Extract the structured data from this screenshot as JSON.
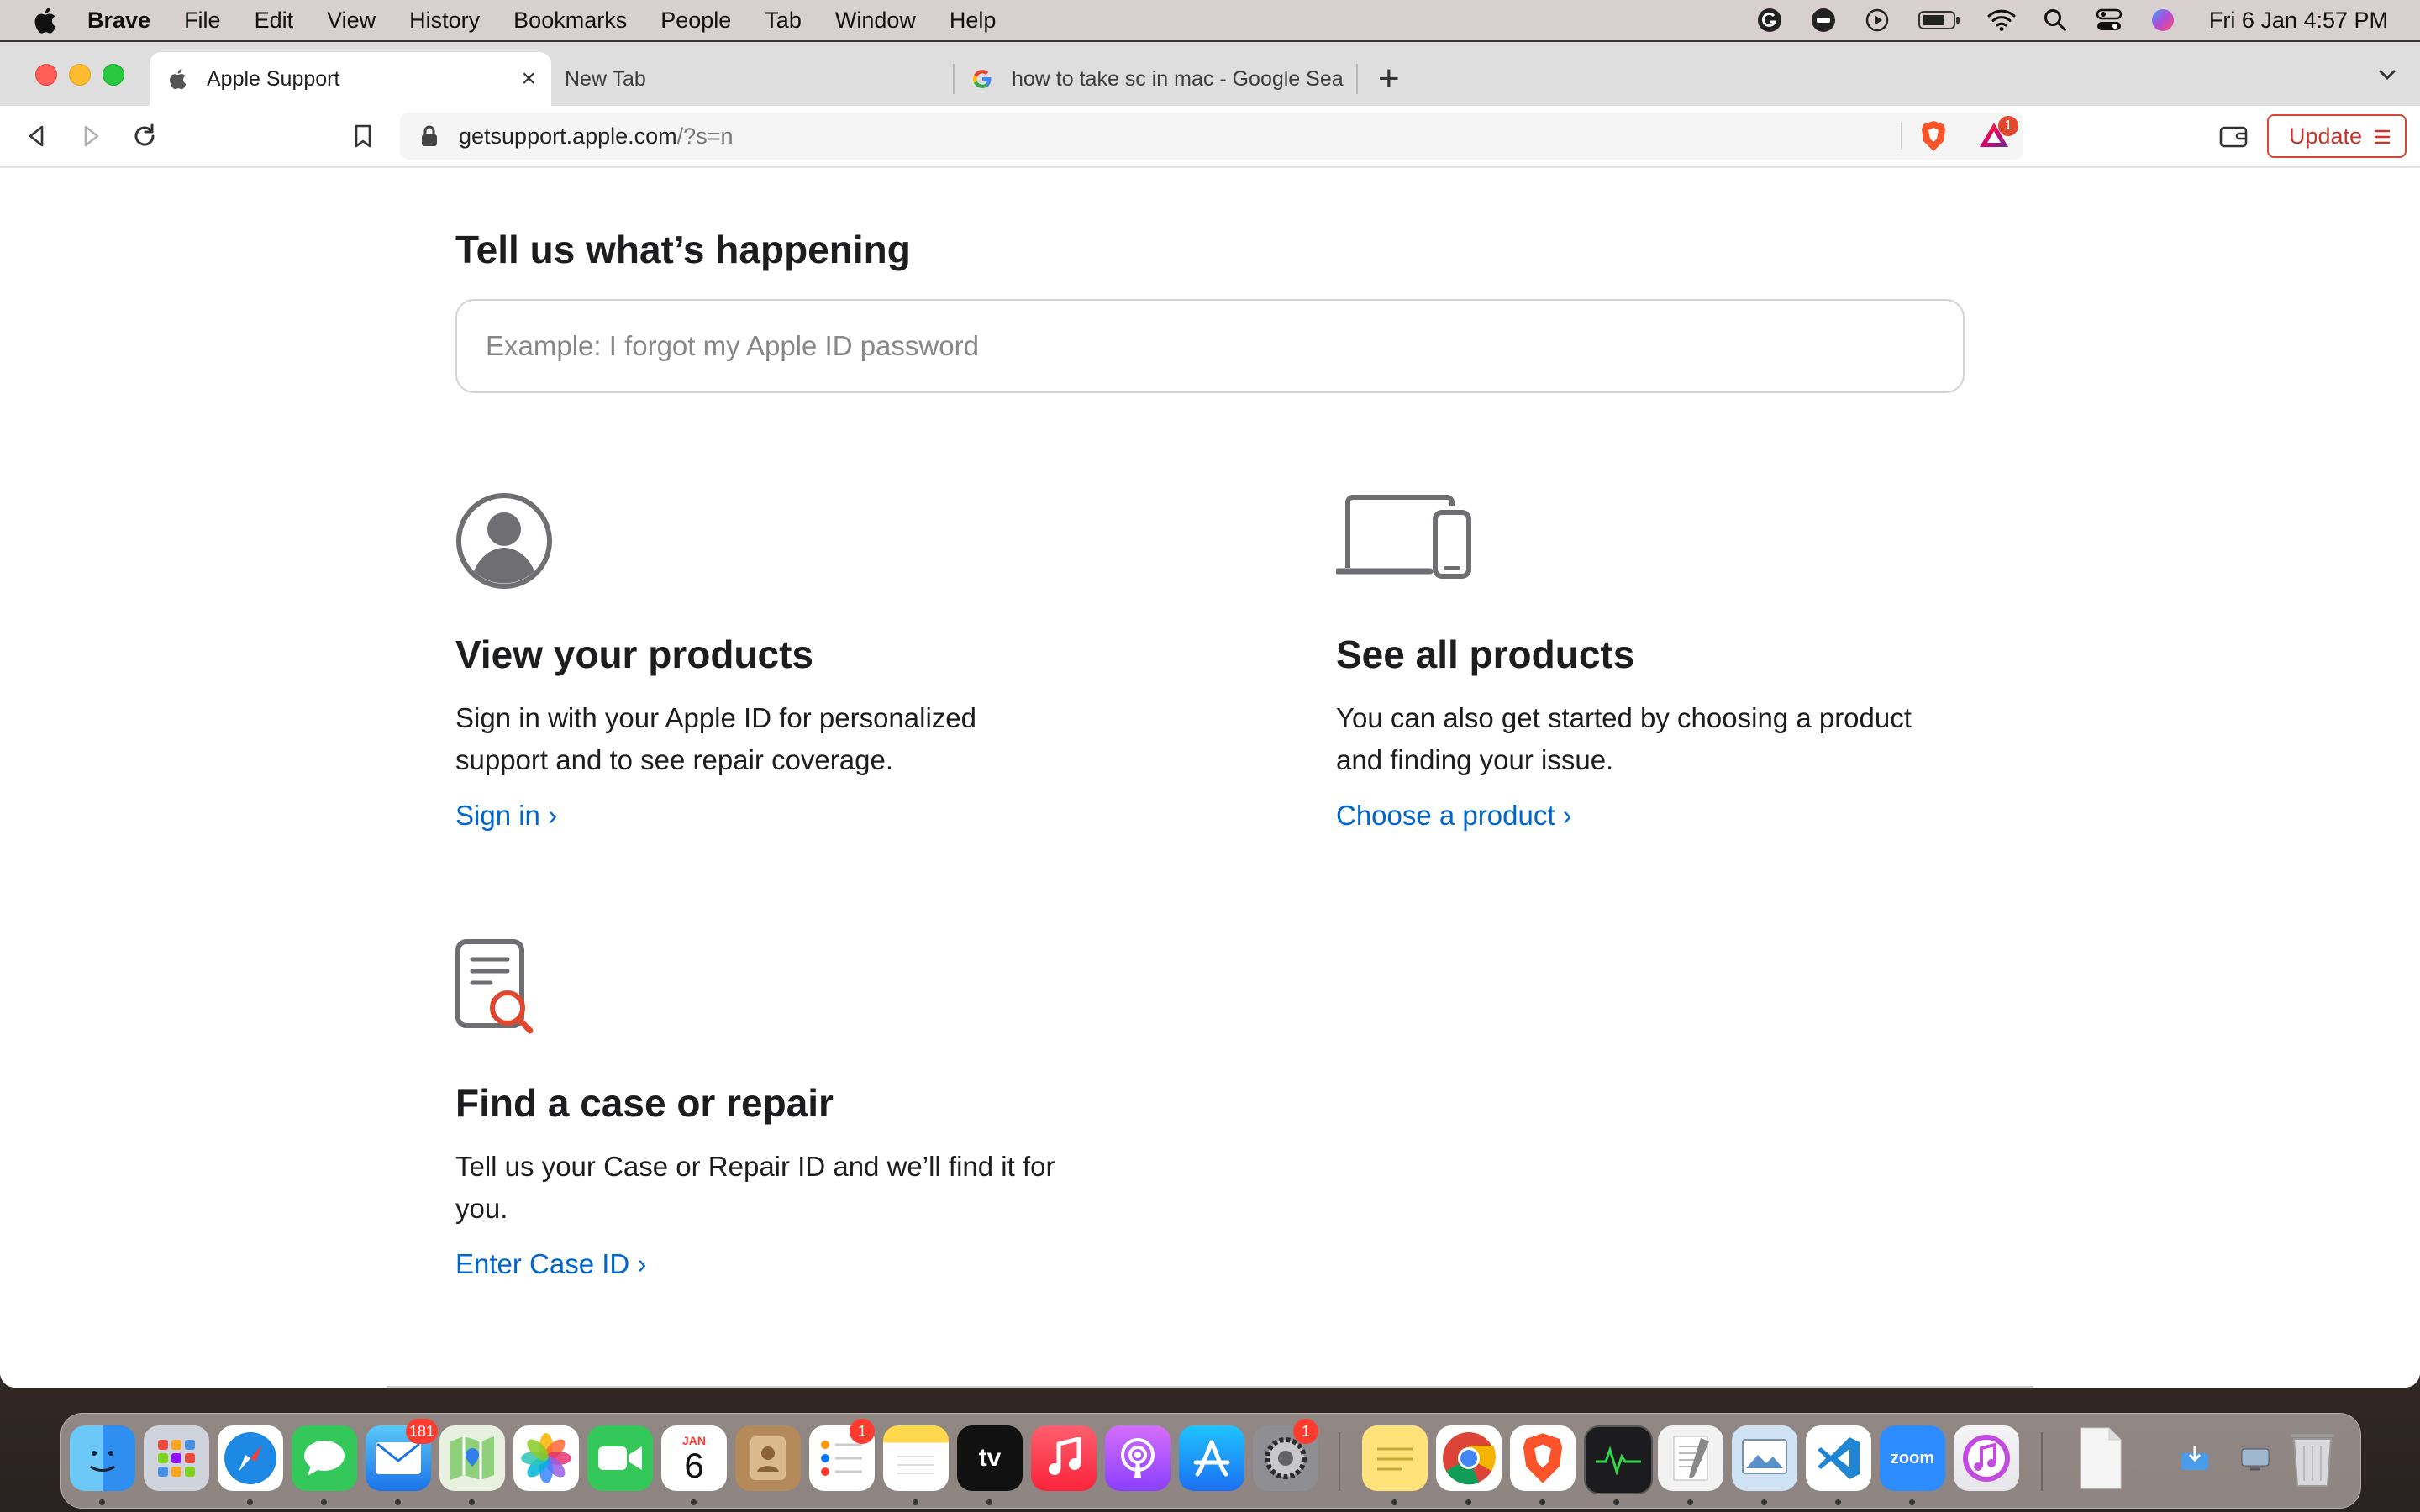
{
  "menubar": {
    "app_name": "Brave",
    "items": [
      "File",
      "Edit",
      "View",
      "History",
      "Bookmarks",
      "People",
      "Tab",
      "Window",
      "Help"
    ],
    "clock": "Fri 6 Jan  4:57 PM"
  },
  "tabs": [
    {
      "title": "Apple Support",
      "active": true
    },
    {
      "title": "New Tab",
      "active": false
    },
    {
      "title": "how to take sc in mac - Google Sea",
      "active": false
    }
  ],
  "toolbar": {
    "url_host": "getsupport.apple.com",
    "url_path": "/?s=n",
    "rewards_count": "1",
    "update_label": "Update"
  },
  "page": {
    "heading": "Tell us what’s happening",
    "search_placeholder": "Example: I forgot my Apple ID password",
    "cards": {
      "view_products": {
        "title": "View your products",
        "line1": "Sign in with your Apple ID for personalized",
        "line2": "support and to see repair coverage.",
        "link": "Sign in ›"
      },
      "all_products": {
        "title": "See all products",
        "line1": "You can also get started by choosing a product",
        "line2": "and finding your issue.",
        "link": "Choose a product ›"
      },
      "find_case": {
        "title": "Find a case or repair",
        "line1": "Tell us your Case or Repair ID and we’ll find it for",
        "line2": "you.",
        "link": "Enter Case ID ›"
      }
    }
  },
  "dock": {
    "mail_badge": "181",
    "reminders_badge": "1",
    "settings_badge": "1",
    "calendar_month": "JAN",
    "calendar_day": "6",
    "tv_label": "tv",
    "zoom_label": "zoom"
  },
  "colors": {
    "link": "#0066cc",
    "text": "#1d1d1f",
    "update_red": "#c9342a"
  }
}
